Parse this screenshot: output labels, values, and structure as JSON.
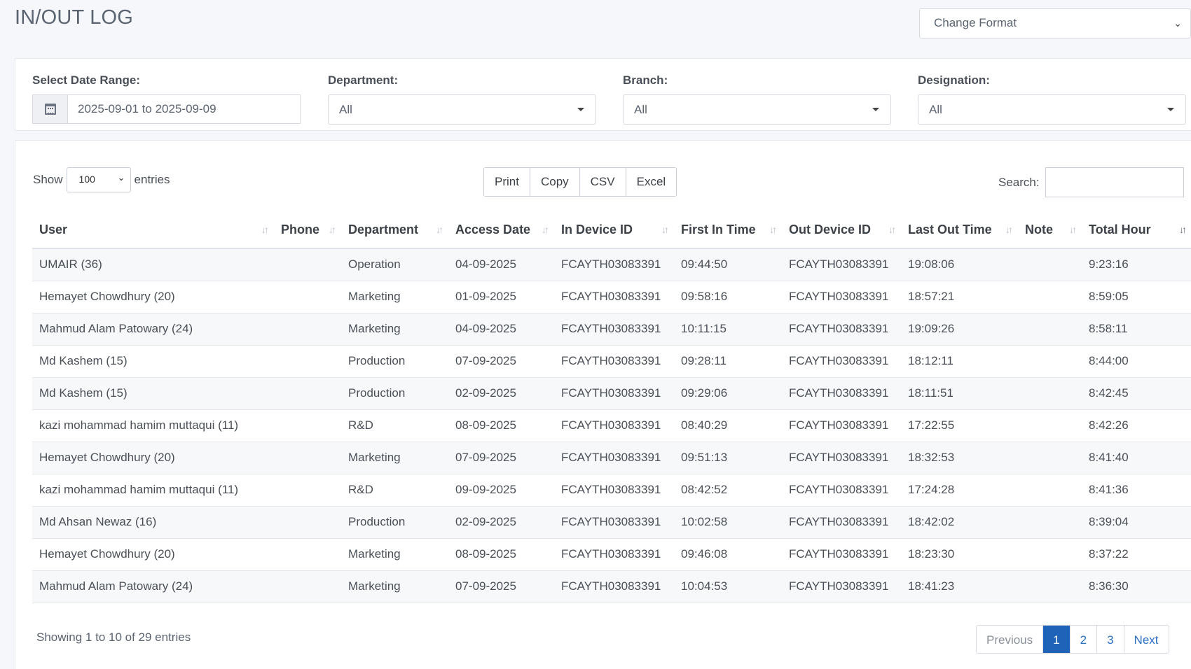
{
  "page": {
    "title": "IN/OUT LOG"
  },
  "format": {
    "label": "Change Format"
  },
  "filters": {
    "date_range": {
      "label": "Select Date Range:",
      "value": "2025-09-01 to 2025-09-09"
    },
    "department": {
      "label": "Department:",
      "value": "All"
    },
    "branch": {
      "label": "Branch:",
      "value": "All"
    },
    "designation": {
      "label": "Designation:",
      "value": "All"
    }
  },
  "controls": {
    "show_label": "Show",
    "entries_value": "100",
    "entries_label": "entries",
    "buttons": [
      "Print",
      "Copy",
      "CSV",
      "Excel"
    ],
    "search_label": "Search:",
    "search_value": ""
  },
  "table": {
    "columns": [
      "User",
      "Phone",
      "Department",
      "Access Date",
      "In Device ID",
      "First In Time",
      "Out Device ID",
      "Last Out Time",
      "Note",
      "Total Hour"
    ],
    "rows": [
      [
        "UMAIR (36)",
        "",
        "Operation",
        "04-09-2025",
        "FCAYTH03083391",
        "09:44:50",
        "FCAYTH03083391",
        "19:08:06",
        "",
        "9:23:16"
      ],
      [
        "Hemayet Chowdhury (20)",
        "",
        "Marketing",
        "01-09-2025",
        "FCAYTH03083391",
        "09:58:16",
        "FCAYTH03083391",
        "18:57:21",
        "",
        "8:59:05"
      ],
      [
        "Mahmud Alam Patowary (24)",
        "",
        "Marketing",
        "04-09-2025",
        "FCAYTH03083391",
        "10:11:15",
        "FCAYTH03083391",
        "19:09:26",
        "",
        "8:58:11"
      ],
      [
        "Md Kashem (15)",
        "",
        "Production",
        "07-09-2025",
        "FCAYTH03083391",
        "09:28:11",
        "FCAYTH03083391",
        "18:12:11",
        "",
        "8:44:00"
      ],
      [
        "Md Kashem (15)",
        "",
        "Production",
        "02-09-2025",
        "FCAYTH03083391",
        "09:29:06",
        "FCAYTH03083391",
        "18:11:51",
        "",
        "8:42:45"
      ],
      [
        "kazi mohammad hamim muttaqui (11)",
        "",
        "R&D",
        "08-09-2025",
        "FCAYTH03083391",
        "08:40:29",
        "FCAYTH03083391",
        "17:22:55",
        "",
        "8:42:26"
      ],
      [
        "Hemayet Chowdhury (20)",
        "",
        "Marketing",
        "07-09-2025",
        "FCAYTH03083391",
        "09:51:13",
        "FCAYTH03083391",
        "18:32:53",
        "",
        "8:41:40"
      ],
      [
        "kazi mohammad hamim muttaqui (11)",
        "",
        "R&D",
        "09-09-2025",
        "FCAYTH03083391",
        "08:42:52",
        "FCAYTH03083391",
        "17:24:28",
        "",
        "8:41:36"
      ],
      [
        "Md Ahsan Newaz (16)",
        "",
        "Production",
        "02-09-2025",
        "FCAYTH03083391",
        "10:02:58",
        "FCAYTH03083391",
        "18:42:02",
        "",
        "8:39:04"
      ],
      [
        "Hemayet Chowdhury (20)",
        "",
        "Marketing",
        "08-09-2025",
        "FCAYTH03083391",
        "09:46:08",
        "FCAYTH03083391",
        "18:23:30",
        "",
        "8:37:22"
      ],
      [
        "Mahmud Alam Patowary (24)",
        "",
        "Marketing",
        "07-09-2025",
        "FCAYTH03083391",
        "10:04:53",
        "FCAYTH03083391",
        "18:41:23",
        "",
        "8:36:30"
      ]
    ]
  },
  "footer": {
    "info": "Showing 1 to 10 of 29 entries",
    "pager": [
      "Previous",
      "1",
      "2",
      "3",
      "Next"
    ],
    "active_page": "1"
  }
}
